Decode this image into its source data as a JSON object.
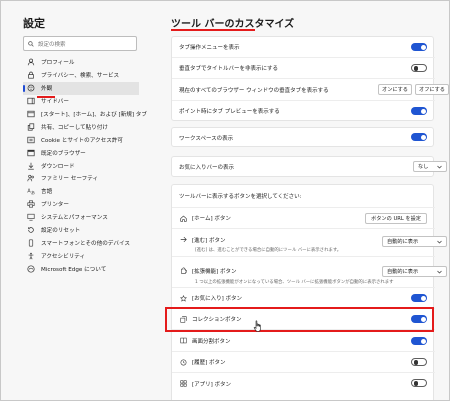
{
  "sidebar": {
    "title": "設定",
    "search_placeholder": "設定の検索",
    "items": [
      {
        "label": "プロフィール",
        "icon": "profile-icon"
      },
      {
        "label": "プライバシー、検索、サービス",
        "icon": "lock-icon"
      },
      {
        "label": "外観",
        "icon": "appearance-icon",
        "active": true
      },
      {
        "label": "サイドバー",
        "icon": "sidebar-icon"
      },
      {
        "label": "[スタート]、[ホーム]、および [新規] タブ",
        "icon": "home-tab-icon"
      },
      {
        "label": "共有、コピーして貼り付け",
        "icon": "share-icon"
      },
      {
        "label": "Cookie とサイトのアクセス許可",
        "icon": "cookie-icon"
      },
      {
        "label": "既定のブラウザー",
        "icon": "browser-icon"
      },
      {
        "label": "ダウンロード",
        "icon": "download-icon"
      },
      {
        "label": "ファミリー セーフティ",
        "icon": "family-icon"
      },
      {
        "label": "言語",
        "icon": "language-icon"
      },
      {
        "label": "プリンター",
        "icon": "printer-icon"
      },
      {
        "label": "システムとパフォーマンス",
        "icon": "system-icon"
      },
      {
        "label": "設定のリセット",
        "icon": "reset-icon"
      },
      {
        "label": "スマートフォンとその他のデバイス",
        "icon": "phone-icon"
      },
      {
        "label": "アクセシビリティ",
        "icon": "accessibility-icon"
      },
      {
        "label": "Microsoft Edge について",
        "icon": "edge-icon"
      }
    ]
  },
  "main": {
    "title": "ツール バーのカスタマイズ",
    "tabs_card": {
      "rows": [
        {
          "label": "タブ操作メニューを表示",
          "toggle": true
        },
        {
          "label": "垂直タブでタイトルバーを非表示にする",
          "toggle": false
        },
        {
          "label": "現在のすべてのブラウザー ウィンドウの垂直タブを表示する",
          "btn_on": "オンにする",
          "btn_off": "オフにする"
        },
        {
          "label": "ポイント時にタブ プレビューを表示する",
          "toggle": true
        }
      ]
    },
    "workspaces": {
      "label": "ワークスペースの表示",
      "toggle": true
    },
    "favorites_bar": {
      "label": "お気に入りバーの表示",
      "value": "なし"
    },
    "buttons_card": {
      "heading": "ツールバーに表示するボタンを選択してください:",
      "home": {
        "label": "[ホーム] ボタン",
        "button": "ボタンの URL を設定"
      },
      "forward": {
        "label": "[進む] ボタン",
        "value": "自動的に表示",
        "desc": "[進む] は、進むことができる場合に自動的にツール バーに表示されます。"
      },
      "extensions": {
        "label": "[拡張機能] ボタン",
        "value": "自動的に表示",
        "desc": "1 つ以上の拡張機能がオンになっている場合、ツール バーに拡張機能ボタンが自動的に表示されます"
      },
      "toggles": [
        {
          "label": "[お気に入り] ボタン",
          "toggle": true,
          "icon": "favorites-icon"
        },
        {
          "label": "コレクションボタン",
          "toggle": true,
          "icon": "collections-icon"
        },
        {
          "label": "画面分割ボタン",
          "toggle": true,
          "icon": "split-screen-icon"
        },
        {
          "label": "[履歴] ボタン",
          "toggle": false,
          "icon": "history-icon"
        },
        {
          "label": "[アプリ] ボタン",
          "toggle": false,
          "icon": "apps-icon"
        }
      ]
    }
  },
  "colors": {
    "accent": "#1f55d2",
    "highlight": "#e41b1b",
    "active_indicator": "#1f4bd4"
  }
}
